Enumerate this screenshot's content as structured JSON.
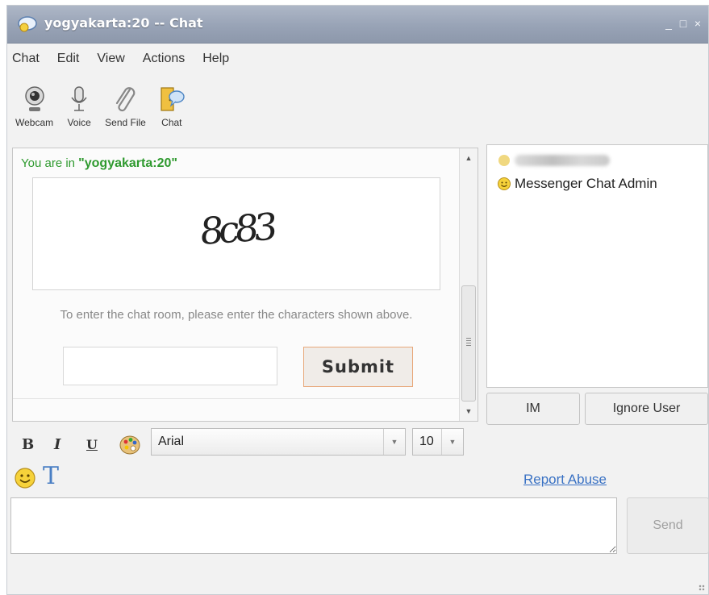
{
  "window": {
    "title": "yogyakarta:20 -- Chat",
    "controls": {
      "minimize": "_",
      "maximize": "□",
      "close": "×"
    }
  },
  "menu": [
    "Chat",
    "Edit",
    "View",
    "Actions",
    "Help"
  ],
  "toolbar": [
    {
      "label": "Webcam",
      "icon": "webcam-icon"
    },
    {
      "label": "Voice",
      "icon": "microphone-icon"
    },
    {
      "label": "Send File",
      "icon": "paperclip-icon"
    },
    {
      "label": "Chat",
      "icon": "chat-door-icon"
    }
  ],
  "chat": {
    "room_prefix": "You are in ",
    "room_name": "\"yogyakarta:20\"",
    "captcha_text": "8c83",
    "instructions": "To enter the chat room, please enter the characters shown above.",
    "captcha_input_value": "",
    "submit_label": "Submit"
  },
  "users": [
    {
      "name": "",
      "blurred": true
    },
    {
      "name": "Messenger Chat Admin",
      "blurred": false
    }
  ],
  "user_actions": {
    "im_label": "IM",
    "ignore_label": "Ignore User"
  },
  "format": {
    "bold": "B",
    "italic": "I",
    "underline": "U",
    "font": "Arial",
    "font_size": "10",
    "text_style": "T"
  },
  "report_abuse": "Report Abuse",
  "message_input_value": "",
  "send_label": "Send",
  "colors": {
    "room_green": "#2f9a2f",
    "link_blue": "#3a72c4",
    "submit_border": "#e8a87a"
  }
}
